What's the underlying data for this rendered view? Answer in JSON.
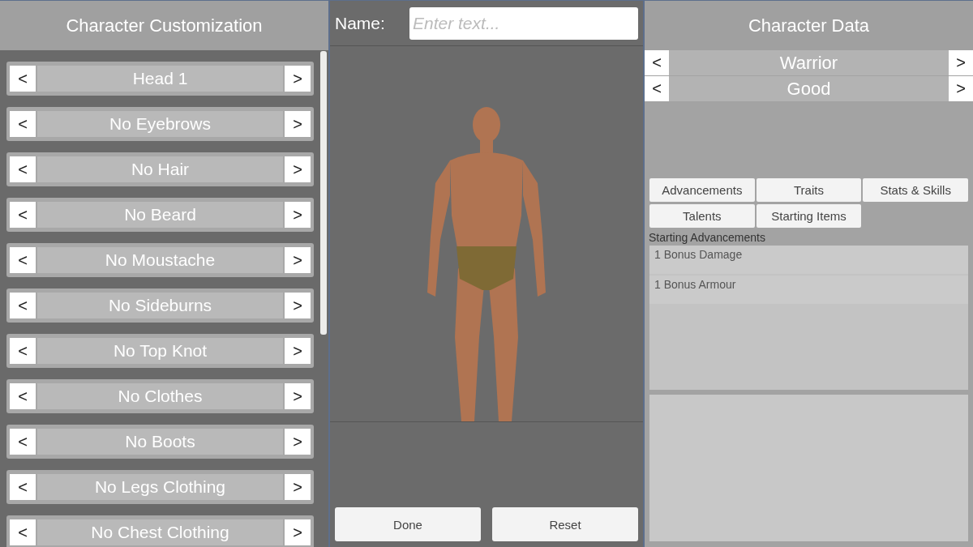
{
  "customization": {
    "title": "Character Customization",
    "options": [
      {
        "prev": "<",
        "label": "Head 1",
        "next": ">"
      },
      {
        "prev": "<",
        "label": "No Eyebrows",
        "next": ">"
      },
      {
        "prev": "<",
        "label": "No Hair",
        "next": ">"
      },
      {
        "prev": "<",
        "label": "No Beard",
        "next": ">"
      },
      {
        "prev": "<",
        "label": "No Moustache",
        "next": ">"
      },
      {
        "prev": "<",
        "label": "No Sideburns",
        "next": ">"
      },
      {
        "prev": "<",
        "label": "No Top Knot",
        "next": ">"
      },
      {
        "prev": "<",
        "label": "No Clothes",
        "next": ">"
      },
      {
        "prev": "<",
        "label": "No Boots",
        "next": ">"
      },
      {
        "prev": "<",
        "label": "No Legs Clothing",
        "next": ">"
      },
      {
        "prev": "<",
        "label": "No Chest Clothing",
        "next": ">"
      }
    ]
  },
  "preview": {
    "name_label": "Name:",
    "name_field": {
      "placeholder": "Enter text..."
    },
    "buttons": [
      "Done",
      "Reset"
    ]
  },
  "character_data": {
    "title": "Character Data",
    "selectors": [
      {
        "prev": "<",
        "label": "Warrior",
        "next": ">"
      },
      {
        "prev": "<",
        "label": "Good",
        "next": ">"
      }
    ],
    "tabs": [
      "Advancements",
      "Traits",
      "Stats & Skills",
      "Talents",
      "Starting Items"
    ],
    "section_title": "Starting Advancements",
    "items": [
      "1 Bonus Damage",
      "1 Bonus Armour"
    ]
  }
}
